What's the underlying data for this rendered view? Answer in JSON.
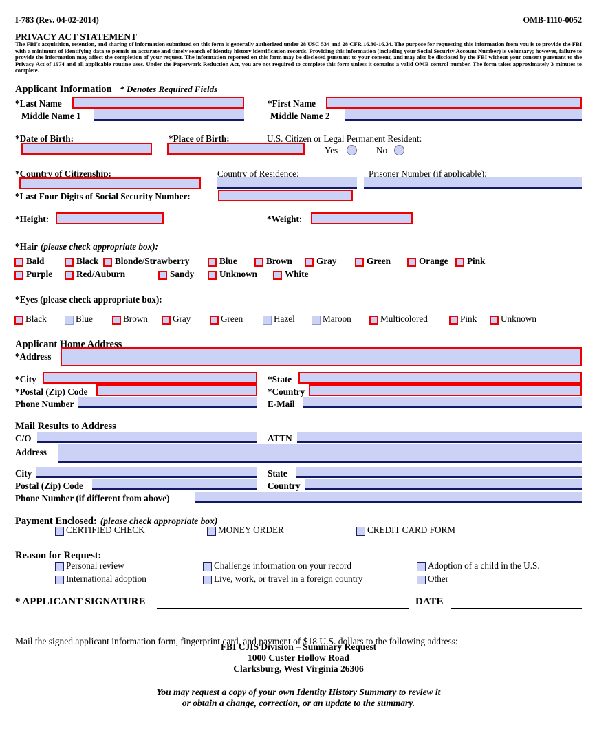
{
  "header": {
    "form_number": "I-783 (Rev. 04-02-2014)",
    "omb_number": "OMB-1110-0052"
  },
  "privacy": {
    "title": "PRIVACY ACT STATEMENT",
    "body": "The FBI's acquisition, retention, and sharing of information submitted on this form is generally authorized under 28 USC 534 and 28 CFR 16.30-16.34.  The purpose for requesting this information from you is to provide the FBI with a minimum of identifying data to permit an accurate and timely search of identity history identification records. Providing this information (including your Social Security Account Number) is voluntary; however, failure to provide the information may affect the completion of your request. The information reported on this form may be disclosed pursuant to your consent, and may also be disclosed by the FBI without your consent pursuant to the Privacy Act of 1974 and all applicable routine uses. Under the Paperwork Reduction Act, you are not required to complete this form unless it contains a valid OMB control number. The form takes approximately 3 minutes to complete."
  },
  "applicant_information": {
    "heading": "Applicant Information",
    "required_note": "* Denotes Required Fields",
    "last_name_label": "*Last Name",
    "last_name_value": "",
    "first_name_label": "*First Name",
    "first_name_value": "",
    "middle_name_1_label": "Middle Name 1",
    "middle_name_1_value": "",
    "middle_name_2_label": "Middle Name 2",
    "middle_name_2_value": "",
    "date_of_birth_label": "*Date of Birth:",
    "date_of_birth_value": "",
    "place_of_birth_label": "*Place of Birth:",
    "place_of_birth_value": "",
    "citizen_question": "U.S. Citizen or Legal Permanent Resident:",
    "citizen_yes_label": "Yes",
    "citizen_no_label": "No",
    "country_citizenship_label": "*Country of Citizenship:",
    "country_citizenship_value": "",
    "country_residence_label": "Country of Residence:",
    "country_residence_value": "",
    "prisoner_number_label": "Prisoner Number (if applicable):",
    "prisoner_number_value": "",
    "ssn_label": "*Last Four Digits of Social Security Number:",
    "ssn_value": "",
    "height_label": "*Height:",
    "height_value": "",
    "weight_label": "*Weight:",
    "weight_value": ""
  },
  "hair": {
    "label": "*Hair",
    "note": "(please check appropriate box):",
    "options": [
      {
        "label": "Bald",
        "style": "red"
      },
      {
        "label": "Black",
        "style": "red"
      },
      {
        "label": "Blonde/Strawberry",
        "style": "red"
      },
      {
        "label": "Blue",
        "style": "red"
      },
      {
        "label": "Brown",
        "style": "red"
      },
      {
        "label": "Gray",
        "style": "red"
      },
      {
        "label": "Green",
        "style": "red"
      },
      {
        "label": "Orange",
        "style": "red"
      },
      {
        "label": "Pink",
        "style": "red"
      },
      {
        "label": "Purple",
        "style": "red"
      },
      {
        "label": "Red/Auburn",
        "style": "red"
      },
      {
        "label": "Sandy",
        "style": "red"
      },
      {
        "label": "Unknown",
        "style": "red"
      },
      {
        "label": "White",
        "style": "red"
      }
    ]
  },
  "eyes": {
    "label": "*Eyes (please check appropriate box):",
    "options": [
      {
        "label": "Black",
        "style": "red"
      },
      {
        "label": "Blue",
        "style": "blue"
      },
      {
        "label": "Brown",
        "style": "red"
      },
      {
        "label": "Gray",
        "style": "red"
      },
      {
        "label": "Green",
        "style": "red"
      },
      {
        "label": "Hazel",
        "style": "blue"
      },
      {
        "label": "Maroon",
        "style": "blue"
      },
      {
        "label": "Multicolored",
        "style": "red"
      },
      {
        "label": "Pink",
        "style": "red"
      },
      {
        "label": "Unknown",
        "style": "red"
      }
    ]
  },
  "home_address": {
    "heading": "Applicant Home Address",
    "address_label": "*Address",
    "address_value": "",
    "city_label": "*City",
    "city_value": "",
    "state_label": "*State",
    "state_value": "",
    "postal_label": "*Postal (Zip) Code",
    "postal_value": "",
    "country_label": "*Country",
    "country_value": "",
    "phone_label": "Phone Number",
    "phone_value": "",
    "email_label": "E-Mail",
    "email_value": ""
  },
  "mail_results": {
    "heading": "Mail Results to Address",
    "co_label": "C/O",
    "co_value": "",
    "attn_label": "ATTN",
    "attn_value": "",
    "address_label": "Address",
    "address_value": "",
    "city_label": "City",
    "city_value": "",
    "state_label": "State",
    "state_value": "",
    "postal_label": "Postal (Zip) Code",
    "postal_value": "",
    "country_label": "Country",
    "country_value": "",
    "phone_label": "Phone Number (if different from above)",
    "phone_value": ""
  },
  "payment": {
    "heading": "Payment Enclosed:",
    "note": "(please check appropriate box)",
    "options": [
      {
        "label": "CERTIFIED CHECK"
      },
      {
        "label": "MONEY ORDER"
      },
      {
        "label": "CREDIT CARD FORM"
      }
    ]
  },
  "reason": {
    "heading": "Reason for Request:",
    "options": [
      {
        "label": "Personal review"
      },
      {
        "label": "Challenge information on your record"
      },
      {
        "label": "Adoption of a child in the U.S."
      },
      {
        "label": "International adoption"
      },
      {
        "label": "Live, work, or travel in a foreign country"
      },
      {
        "label": "Other"
      }
    ]
  },
  "signature": {
    "signature_label": "* APPLICANT SIGNATURE",
    "date_label": "DATE"
  },
  "footer": {
    "mail_instruction": "Mail the signed applicant information form, fingerprint card, and payment of $18 U.S. dollars to the following address:",
    "address_line_1": "FBI CJIS Division – Summary Request",
    "address_line_2": "1000 Custer Hollow Road",
    "address_line_3": "Clarksburg, West Virginia 26306",
    "note_line_1": "You may request a copy of your own Identity History Summary to review it",
    "note_line_2": "or obtain a change, correction, or an update to the summary."
  },
  "colors": {
    "field_fill": "#ccd2f5",
    "required_border": "#ee0000",
    "underline": "#111a62",
    "navy_checkbox": "#1a1f6b"
  }
}
